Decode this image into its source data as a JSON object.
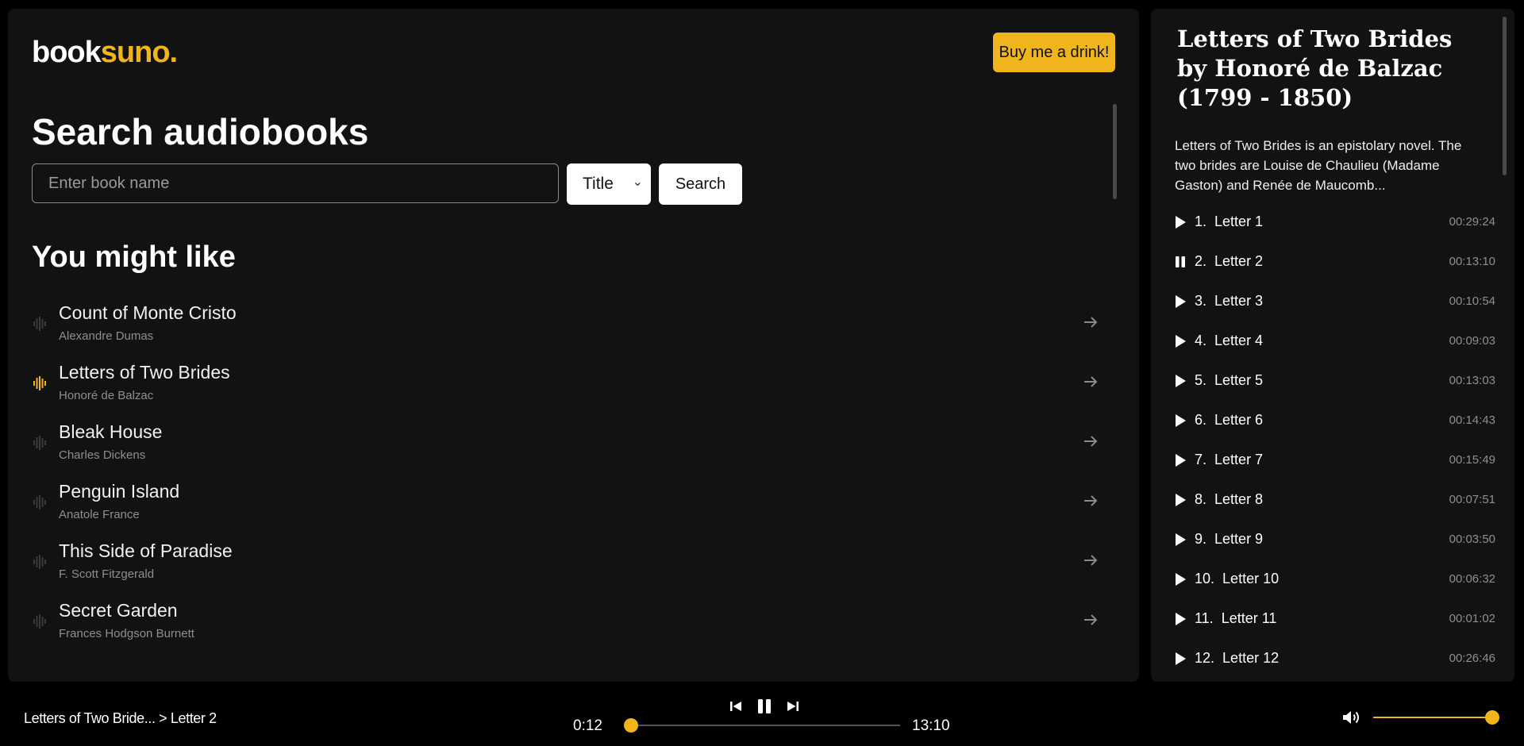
{
  "brand": {
    "part1": "book",
    "part2": "suno.",
    "accent": "#f0b41c"
  },
  "header": {
    "drink_button": "Buy me a drink!"
  },
  "search": {
    "title": "Search audiobooks",
    "placeholder": "Enter book name",
    "type_selected": "Title",
    "button": "Search"
  },
  "recommendations": {
    "title": "You might like",
    "items": [
      {
        "title": "Count of Monte Cristo",
        "author": "Alexandre Dumas",
        "playing": false
      },
      {
        "title": "Letters of Two Brides",
        "author": "Honoré de Balzac",
        "playing": true
      },
      {
        "title": "Bleak House",
        "author": "Charles Dickens",
        "playing": false
      },
      {
        "title": "Penguin Island",
        "author": "Anatole France",
        "playing": false
      },
      {
        "title": "This Side of Paradise",
        "author": "F. Scott Fitzgerald",
        "playing": false
      },
      {
        "title": "Secret Garden",
        "author": "Frances Hodgson Burnett",
        "playing": false
      }
    ]
  },
  "book_detail": {
    "heading": "Letters of Two Brides by Honoré de Balzac (1799 - 1850)",
    "description": "Letters of Two Brides is an epistolary novel. The two brides are Louise de Chaulieu (Madame Gaston) and Renée de Maucomb..."
  },
  "chapters": [
    {
      "num": "1.",
      "title": "Letter 1",
      "duration": "00:29:24",
      "playing": false
    },
    {
      "num": "2.",
      "title": "Letter 2",
      "duration": "00:13:10",
      "playing": true
    },
    {
      "num": "3.",
      "title": "Letter 3",
      "duration": "00:10:54",
      "playing": false
    },
    {
      "num": "4.",
      "title": "Letter 4",
      "duration": "00:09:03",
      "playing": false
    },
    {
      "num": "5.",
      "title": "Letter 5",
      "duration": "00:13:03",
      "playing": false
    },
    {
      "num": "6.",
      "title": "Letter 6",
      "duration": "00:14:43",
      "playing": false
    },
    {
      "num": "7.",
      "title": "Letter 7",
      "duration": "00:15:49",
      "playing": false
    },
    {
      "num": "8.",
      "title": "Letter 8",
      "duration": "00:07:51",
      "playing": false
    },
    {
      "num": "9.",
      "title": "Letter 9",
      "duration": "00:03:50",
      "playing": false
    },
    {
      "num": "10.",
      "title": "Letter 10",
      "duration": "00:06:32",
      "playing": false
    },
    {
      "num": "11.",
      "title": "Letter 11",
      "duration": "00:01:02",
      "playing": false
    },
    {
      "num": "12.",
      "title": "Letter 12",
      "duration": "00:26:46",
      "playing": false
    }
  ],
  "player": {
    "now_playing": "Letters of Two Bride... > Letter 2",
    "current_time": "0:12",
    "total_time": "13:10",
    "progress": 0.015,
    "volume": 1.0
  }
}
